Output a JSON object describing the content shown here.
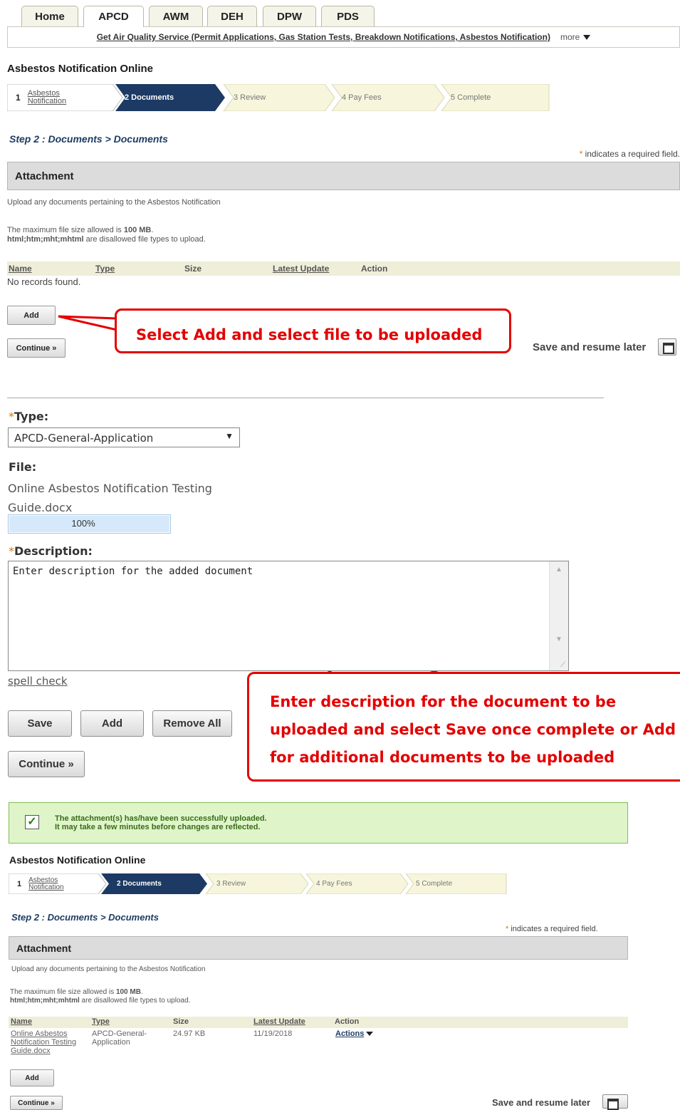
{
  "tabs": [
    "Home",
    "APCD",
    "AWM",
    "DEH",
    "DPW",
    "PDS"
  ],
  "subnav": {
    "link": "Get Air Quality Service (Permit Applications, Gas Station Tests, Breakdown Notifications, Asbestos Notification)",
    "more": "more"
  },
  "page_title": "Asbestos Notification Online",
  "steps": {
    "s1_num": "1",
    "s1_label_a": "Asbestos",
    "s1_label_b": "Notification",
    "s2": "2 Documents",
    "s3": "3 Review",
    "s4": "4 Pay Fees",
    "s5": "5 Complete"
  },
  "step_title": "Step 2 : Documents > Documents",
  "required_note": {
    "star": "*",
    "text": "indicates a required field."
  },
  "section_title": "Attachment",
  "upload_instruction": "Upload any documents pertaining to the Asbestos Notification",
  "max_size_pre": "The maximum file size allowed is ",
  "max_size_val": "100 MB",
  "max_size_post": ".",
  "disallowed_types": "html;htm;mht;mhtml",
  "disallowed_post": " are disallowed file types to upload.",
  "grid_headers": {
    "name": "Name",
    "type": "Type",
    "size": "Size",
    "latest": "Latest Update",
    "action": "Action"
  },
  "no_records": "No records found.",
  "buttons": {
    "add": "Add",
    "continue": "Continue »",
    "save": "Save",
    "remove_all": "Remove All"
  },
  "save_resume": "Save and resume later",
  "callout_1": "Select Add and select file to be uploaded",
  "callout_2": {
    "line1": "Enter description for the document to be",
    "line2": "uploaded and select Save once complete or Add",
    "line3": "for additional documents to be uploaded"
  },
  "form": {
    "type_label": "Type:",
    "type_value": "APCD-General-Application",
    "file_label": "File:",
    "file_line1": "Online Asbestos Notification Testing",
    "file_line2": "Guide.docx",
    "progress_text": "100%",
    "progress": 1.0,
    "desc_label": "Description:",
    "desc_value": "Enter description for the added document",
    "spell_check": "spell check"
  },
  "success": {
    "line1": "The attachment(s) has/have been successfully uploaded.",
    "line2": "It may take a few minutes before changes are reflected."
  },
  "row": {
    "name_1": "Online Asbestos",
    "name_2": "Notification Testing",
    "name_3": "Guide.docx",
    "type_1": "APCD-General-",
    "type_2": "Application",
    "size": "24.97 KB",
    "date": "11/19/2018",
    "action": "Actions"
  }
}
